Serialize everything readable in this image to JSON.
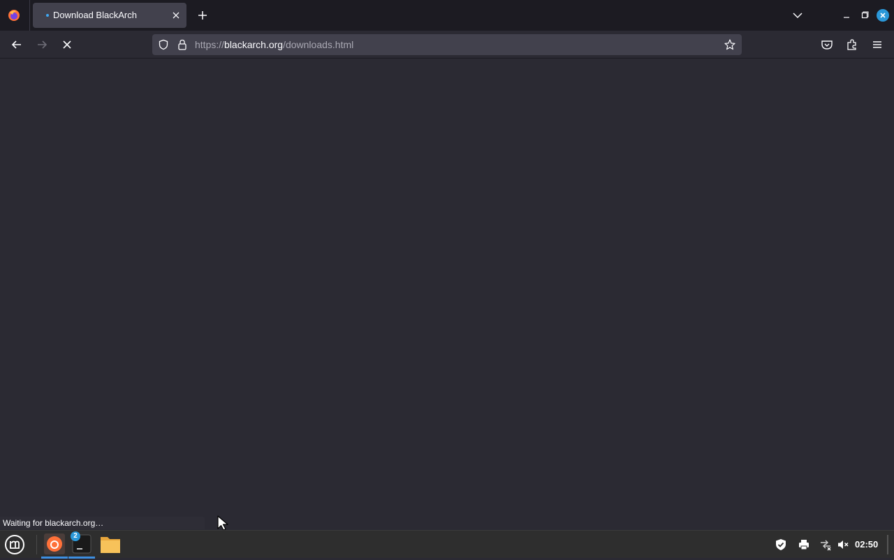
{
  "browser": {
    "tab": {
      "title": "Download BlackArch"
    },
    "url": {
      "scheme": "https://",
      "host": "blackarch.org",
      "path": "/downloads.html"
    },
    "status_text": "Waiting for blackarch.org…",
    "loading": true
  },
  "taskbar": {
    "badge_count": "2",
    "clock": "02:50"
  },
  "colors": {
    "chrome_dark": "#1c1b22",
    "content_bg": "#2b2a33",
    "urlbar_bg": "#42414d",
    "accent": "#2b98d9"
  },
  "icons": [
    "firefox-icon",
    "close-icon",
    "plus-icon",
    "chevron-down-icon",
    "minimize-icon",
    "maximize-icon",
    "back-arrow-icon",
    "forward-arrow-icon",
    "stop-loading-icon",
    "shield-icon",
    "lock-icon",
    "star-icon",
    "pocket-icon",
    "extensions-icon",
    "hamburger-menu-icon",
    "mint-menu-icon",
    "terminal-icon",
    "folder-icon",
    "shield-check-icon",
    "printer-icon",
    "network-icon",
    "volume-muted-icon"
  ]
}
